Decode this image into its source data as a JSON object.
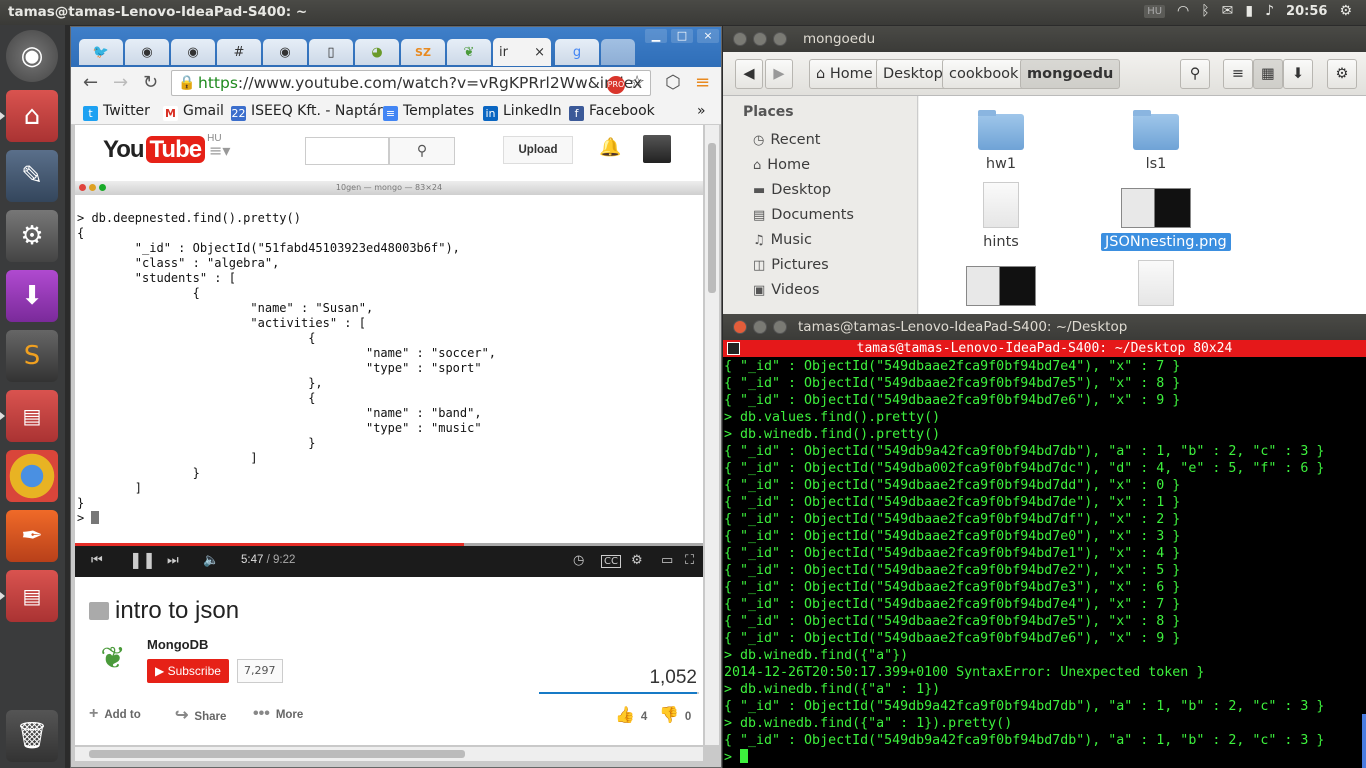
{
  "topbar": {
    "title": "tamas@tamas-Lenovo-IdeaPad-S400: ~",
    "keyboard": "HU",
    "clock": "20:56"
  },
  "launcher": {
    "items": [
      "dash-icon",
      "files-icon",
      "text-editor-icon",
      "settings-icon",
      "installer-icon",
      "sublime-text-icon",
      "terminal-icon",
      "chrome-icon",
      "inkscape-icon",
      "terminal-icon",
      "trash-icon"
    ]
  },
  "browser": {
    "tabs": [
      "",
      "",
      "",
      "#",
      "",
      "",
      "",
      "SZ",
      "",
      "ir",
      "",
      ""
    ],
    "active_tab_label": "ir",
    "url_scheme": "https",
    "url_rest": "://www.youtube.com/watch?v=vRgKPRrl2Ww&index",
    "bookmarks": [
      {
        "label": "Twitter",
        "icon": "twitter-icon",
        "color": "#1da1f2"
      },
      {
        "label": "Gmail",
        "icon": "gmail-icon",
        "color": "#d93025"
      },
      {
        "label": "ISEEQ Kft. - Naptár",
        "icon": "calendar-icon",
        "color": "#3b6ecc"
      },
      {
        "label": "Templates",
        "icon": "docs-icon",
        "color": "#4285f4"
      },
      {
        "label": "LinkedIn",
        "icon": "linkedin-icon",
        "color": "#0a66c2"
      },
      {
        "label": "Facebook",
        "icon": "facebook-icon",
        "color": "#3b5998"
      }
    ],
    "more_bookmarks": "»"
  },
  "youtube": {
    "logo_you": "You",
    "logo_tube": "Tube",
    "logo_region": "HU",
    "upload_label": "Upload",
    "mongo_window_title": "10gen — mongo — 83×24",
    "mongo_console": "> db.deepnested.find().pretty()\n{\n        \"_id\" : ObjectId(\"51fabd45103923ed48003b6f\"),\n        \"class\" : \"algebra\",\n        \"students\" : [\n                {\n                        \"name\" : \"Susan\",\n                        \"activities\" : [\n                                {\n                                        \"name\" : \"soccer\",\n                                        \"type\" : \"sport\"\n                                },\n                                {\n                                        \"name\" : \"band\",\n                                        \"type\" : \"music\"\n                                }\n                        ]\n                }\n        ]\n}\n> ",
    "time_current": "5:47",
    "time_total": "/ 9:22",
    "progress": 0.62,
    "video_title": "intro to json",
    "channel": "MongoDB",
    "subscribe_label": "Subscribe",
    "subscriber_count": "7,297",
    "views": "1,052",
    "actions": {
      "add_to": "Add to",
      "share": "Share",
      "more": "More"
    },
    "likes": "4",
    "dislikes": "0"
  },
  "file_manager": {
    "title": "mongoedu",
    "breadcrumbs": [
      "Home",
      "Desktop",
      "cookbook",
      "mongoedu"
    ],
    "places_header": "Places",
    "places": [
      "Recent",
      "Home",
      "Desktop",
      "Documents",
      "Music",
      "Pictures",
      "Videos"
    ],
    "files": [
      {
        "name": "hw1",
        "type": "folder"
      },
      {
        "name": "ls1",
        "type": "folder"
      },
      {
        "name": "hints",
        "type": "document"
      },
      {
        "name": "JSONnesting.png",
        "type": "image",
        "selected": true
      },
      {
        "name": "",
        "type": "image"
      },
      {
        "name": "",
        "type": "document"
      }
    ]
  },
  "terminal": {
    "window_title": "tamas@tamas-Lenovo-IdeaPad-S400: ~/Desktop",
    "tab_title": "tamas@tamas-Lenovo-IdeaPad-S400: ~/Desktop 80x24",
    "output": "{ \"_id\" : ObjectId(\"549dbaae2fca9f0bf94bd7e4\"), \"x\" : 7 }\n{ \"_id\" : ObjectId(\"549dbaae2fca9f0bf94bd7e5\"), \"x\" : 8 }\n{ \"_id\" : ObjectId(\"549dbaae2fca9f0bf94bd7e6\"), \"x\" : 9 }\n> db.values.find().pretty()\n> db.winedb.find().pretty()\n{ \"_id\" : ObjectId(\"549db9a42fca9f0bf94bd7db\"), \"a\" : 1, \"b\" : 2, \"c\" : 3 }\n{ \"_id\" : ObjectId(\"549dba002fca9f0bf94bd7dc\"), \"d\" : 4, \"e\" : 5, \"f\" : 6 }\n{ \"_id\" : ObjectId(\"549dbaae2fca9f0bf94bd7dd\"), \"x\" : 0 }\n{ \"_id\" : ObjectId(\"549dbaae2fca9f0bf94bd7de\"), \"x\" : 1 }\n{ \"_id\" : ObjectId(\"549dbaae2fca9f0bf94bd7df\"), \"x\" : 2 }\n{ \"_id\" : ObjectId(\"549dbaae2fca9f0bf94bd7e0\"), \"x\" : 3 }\n{ \"_id\" : ObjectId(\"549dbaae2fca9f0bf94bd7e1\"), \"x\" : 4 }\n{ \"_id\" : ObjectId(\"549dbaae2fca9f0bf94bd7e2\"), \"x\" : 5 }\n{ \"_id\" : ObjectId(\"549dbaae2fca9f0bf94bd7e3\"), \"x\" : 6 }\n{ \"_id\" : ObjectId(\"549dbaae2fca9f0bf94bd7e4\"), \"x\" : 7 }\n{ \"_id\" : ObjectId(\"549dbaae2fca9f0bf94bd7e5\"), \"x\" : 8 }\n{ \"_id\" : ObjectId(\"549dbaae2fca9f0bf94bd7e6\"), \"x\" : 9 }\n> db.winedb.find({\"a\"})\n2014-12-26T20:50:17.399+0100 SyntaxError: Unexpected token }\n> db.winedb.find({\"a\" : 1})\n{ \"_id\" : ObjectId(\"549db9a42fca9f0bf94bd7db\"), \"a\" : 1, \"b\" : 2, \"c\" : 3 }\n> db.winedb.find({\"a\" : 1}).pretty()\n{ \"_id\" : ObjectId(\"549db9a42fca9f0bf94bd7db\"), \"a\" : 1, \"b\" : 2, \"c\" : 3 }\n> "
  }
}
